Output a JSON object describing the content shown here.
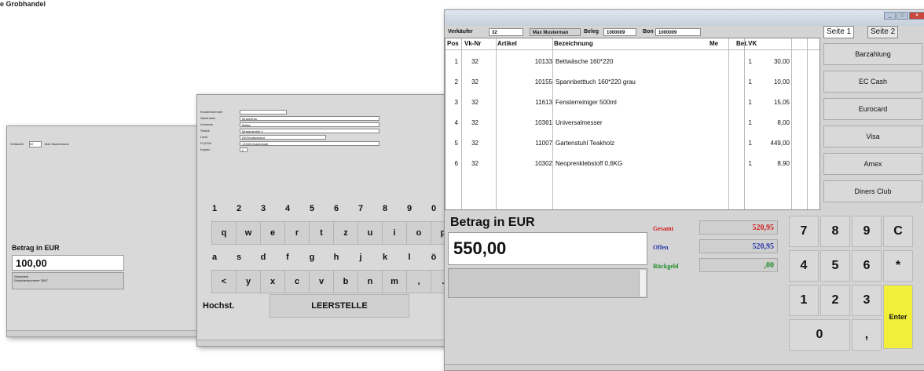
{
  "caption": "e Grobhandel",
  "window_small": {
    "header_label": "Verkäufer",
    "header_value": "32",
    "header_name": "Max Mustermann",
    "amount_label": "Betrag in EUR",
    "amount_value": "100,00",
    "info_line1": "Gutschein",
    "info_line2": "Gutscheinnummer  3067"
  },
  "window_keyboard": {
    "fields": [
      {
        "label": "Kundennummer",
        "value": ""
      },
      {
        "label": "Nachname",
        "value": "Musterfrau"
      },
      {
        "label": "Vorname",
        "value": "Meike"
      },
      {
        "label": "Straße",
        "value": "Musterstraße 1"
      },
      {
        "label": "Land",
        "value": "DE/Deutschland"
      },
      {
        "label": "PLZ/Ort",
        "value": "12345   Musterstadt"
      },
      {
        "label": "Kopien",
        "value": "2"
      }
    ],
    "row1": [
      "1",
      "2",
      "3",
      "4",
      "5",
      "6",
      "7",
      "8",
      "9",
      "0"
    ],
    "row2": [
      "q",
      "w",
      "e",
      "r",
      "t",
      "z",
      "u",
      "i",
      "o",
      "p"
    ],
    "row3": [
      "a",
      "s",
      "d",
      "f",
      "g",
      "h",
      "j",
      "k",
      "l",
      "ö"
    ],
    "row4": [
      "<",
      "y",
      "x",
      "c",
      "v",
      "b",
      "n",
      "m",
      ",",
      "."
    ],
    "shift_label": "Hochst.",
    "space_label": "LEERSTELLE"
  },
  "window_pos": {
    "header": {
      "seller_label": "Verkäufer",
      "seller_value": "32",
      "name": "Max Musterman",
      "receipt_label": "Beleg",
      "receipt_value": "1000009",
      "bon_label": "Bon",
      "bon_value": "1000009"
    },
    "columns": [
      "Pos",
      "Vk-Nr",
      "Artikel",
      "Bezeichnung",
      "Me",
      "Bet.VK"
    ],
    "rows": [
      [
        "1",
        "32",
        "10133",
        "Bettwäsche 160*220",
        "1",
        "30,00"
      ],
      [
        "2",
        "32",
        "10155",
        "Spannbetttuch 160*220 grau",
        "1",
        "10,00"
      ],
      [
        "3",
        "32",
        "11613",
        "Fensterreiniger 500ml",
        "1",
        "15,05"
      ],
      [
        "4",
        "32",
        "10361",
        "Universalmesser",
        "1",
        "8,00"
      ],
      [
        "5",
        "32",
        "11007",
        "Gartenstuhl Teakholz",
        "1",
        "449,00"
      ],
      [
        "6",
        "32",
        "10302",
        "Neoprenklebstoff 0,6KG",
        "1",
        "8,90"
      ]
    ],
    "tabs": [
      "Seite 1",
      "Seite 2"
    ],
    "payment_buttons": [
      "Barzahlung",
      "EC Cash",
      "Eurocard",
      "Visa",
      "Amex",
      "Diners Club"
    ],
    "amount_label": "Betrag in EUR",
    "amount_value": "550,00",
    "totals": [
      {
        "label": "Gesamt",
        "value": "520,95",
        "color": "#d22020"
      },
      {
        "label": "Offen",
        "value": "520,95",
        "color": "#2a3aa8"
      },
      {
        "label": "Rückgeld",
        "value": ",00",
        "color": "#1f8a2a"
      }
    ],
    "numpad": [
      "7",
      "8",
      "9",
      "C",
      "4",
      "5",
      "6",
      "*",
      "1",
      "2",
      "3",
      "0",
      ",",
      "Enter"
    ],
    "enter_color": "#f2ef3a"
  }
}
